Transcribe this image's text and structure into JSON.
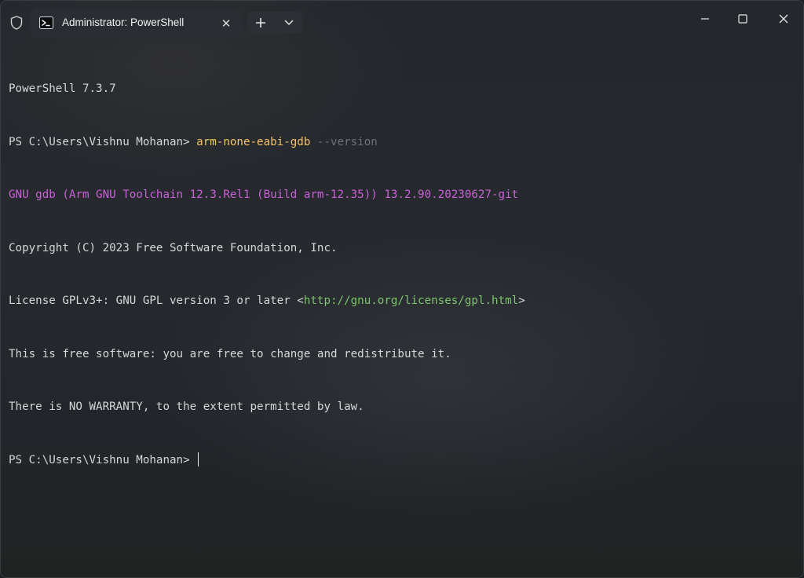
{
  "window": {
    "tab_title": "Administrator: PowerShell",
    "close_tab_glyph": "✕",
    "new_tab_glyph": "+",
    "icons": {
      "admin": "shield-icon",
      "tab": "powershell-icon",
      "new_tab": "plus-icon",
      "dropdown": "chevron-down-icon",
      "minimize": "minimize-icon",
      "maximize": "maximize-icon",
      "close": "close-icon"
    }
  },
  "terminal": {
    "version_line": "PowerShell 7.3.7",
    "prompt1": "PS C:\\Users\\Vishnu Mohanan> ",
    "command": "arm-none-eabi-gdb",
    "command_param": " --version",
    "gdb_version": "GNU gdb (Arm GNU Toolchain 12.3.Rel1 (Build arm-12.35)) 13.2.90.20230627-git",
    "copyright": "Copyright (C) 2023 Free Software Foundation, Inc.",
    "license_prefix": "License GPLv3+: GNU GPL version 3 or later <",
    "license_url": "http://gnu.org/licenses/gpl.html",
    "license_suffix": ">",
    "free_software": "This is free software: you are free to change and redistribute it.",
    "warranty": "There is NO WARRANTY, to the extent permitted by law.",
    "prompt2": "PS C:\\Users\\Vishnu Mohanan> "
  },
  "colors": {
    "command": "#f4c36b",
    "parameter": "#6e7077",
    "gdb_banner": "#c862d6",
    "link": "#7ec46c",
    "text": "#d6d6d6"
  }
}
